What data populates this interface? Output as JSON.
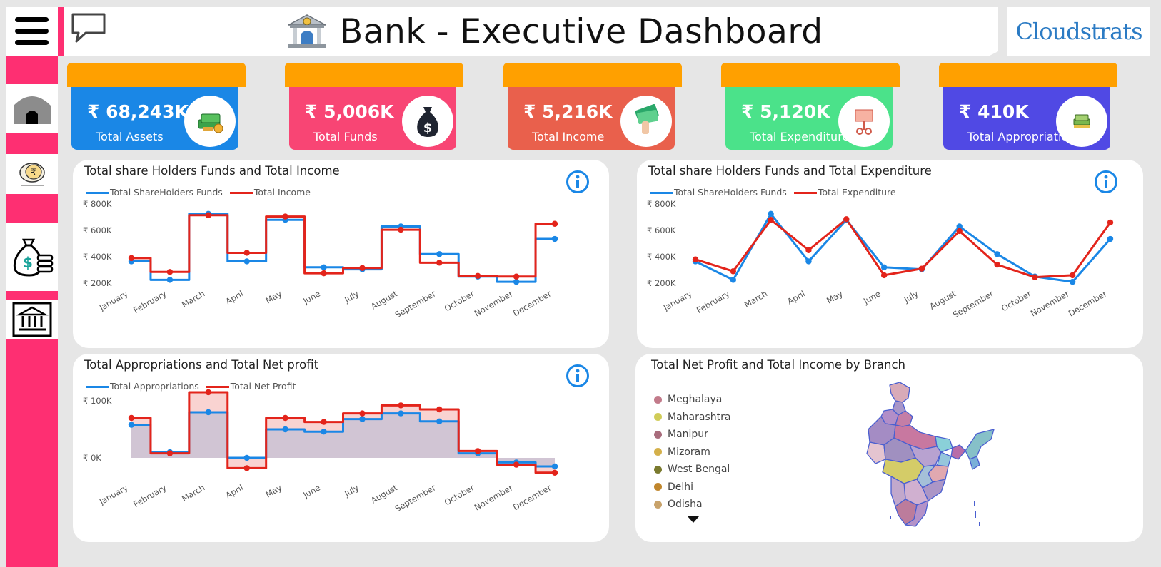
{
  "header": {
    "title": "Bank - Executive Dashboard",
    "logo_text": "Cloudstrats"
  },
  "sidebar": {
    "items": [
      {
        "icon": "home-icon"
      },
      {
        "icon": "rupee-coin-icon"
      },
      {
        "icon": "money-bag-icon"
      },
      {
        "icon": "bank-building-icon"
      }
    ]
  },
  "kpis": [
    {
      "value": "₹ 68,243K",
      "label": "Total Assets",
      "color": "#1a87e6",
      "icon": "cash-stack-icon"
    },
    {
      "value": "₹ 5,006K",
      "label": "Total Funds",
      "color": "#f84574",
      "icon": "money-bag-icon"
    },
    {
      "value": "₹ 5,216K",
      "label": "Total Income",
      "color": "#e9604c",
      "icon": "cash-hand-icon"
    },
    {
      "value": "₹ 5,120K",
      "label": "Total Expenditure",
      "color": "#4be28a",
      "icon": "money-tree-icon"
    },
    {
      "value": "₹ 410K",
      "label": "Total Appropriations",
      "color": "#5049e4",
      "icon": "cash-bundle-icon"
    }
  ],
  "charts": {
    "funds_income": {
      "title": "Total share Holders Funds and Total Income"
    },
    "funds_expenditure": {
      "title": "Total share Holders Funds and Total Expenditure"
    },
    "appropriations_profit": {
      "title": "Total Appropriations and Total Net profit"
    },
    "map": {
      "title": "Total Net Profit and Total Income by Branch",
      "legend": [
        {
          "name": "Meghalaya",
          "color": "#c27a8a"
        },
        {
          "name": "Maharashtra",
          "color": "#d0cc58"
        },
        {
          "name": "Manipur",
          "color": "#a86c7c"
        },
        {
          "name": "Mizoram",
          "color": "#d4b04a"
        },
        {
          "name": "West Bengal",
          "color": "#7a7a2e"
        },
        {
          "name": "Delhi",
          "color": "#c0862c"
        },
        {
          "name": "Odisha",
          "color": "#c8a26a"
        }
      ]
    }
  },
  "chart_data": [
    {
      "type": "line",
      "title": "Total share Holders Funds and Total Income",
      "categories": [
        "January",
        "February",
        "March",
        "April",
        "May",
        "June",
        "July",
        "August",
        "September",
        "October",
        "November",
        "December"
      ],
      "series": [
        {
          "name": "Total ShareHolders Funds",
          "color": "#1a87e6",
          "values": [
            365,
            225,
            725,
            365,
            680,
            320,
            305,
            630,
            420,
            250,
            210,
            535
          ]
        },
        {
          "name": "Total Income",
          "color": "#e3241b",
          "values": [
            390,
            285,
            715,
            430,
            705,
            275,
            315,
            605,
            355,
            255,
            250,
            650
          ]
        }
      ],
      "y_ticks": [
        "₹ 200K",
        "₹ 400K",
        "₹ 600K",
        "₹ 800K"
      ],
      "ylim": [
        200,
        800
      ],
      "step": true,
      "legend": "top-left"
    },
    {
      "type": "line",
      "title": "Total share Holders Funds and Total Expenditure",
      "categories": [
        "January",
        "February",
        "March",
        "April",
        "May",
        "June",
        "July",
        "August",
        "September",
        "October",
        "November",
        "December"
      ],
      "series": [
        {
          "name": "Total ShareHolders Funds",
          "color": "#1a87e6",
          "values": [
            365,
            225,
            725,
            365,
            680,
            320,
            305,
            630,
            420,
            250,
            210,
            535
          ]
        },
        {
          "name": "Total Expenditure",
          "color": "#e3241b",
          "values": [
            380,
            290,
            680,
            450,
            685,
            260,
            310,
            595,
            340,
            245,
            260,
            660
          ]
        }
      ],
      "y_ticks": [
        "₹ 200K",
        "₹ 400K",
        "₹ 600K",
        "₹ 800K"
      ],
      "ylim": [
        200,
        800
      ],
      "step": false,
      "legend": "top-left"
    },
    {
      "type": "area",
      "title": "Total Appropriations and Total Net profit",
      "categories": [
        "January",
        "February",
        "March",
        "April",
        "May",
        "June",
        "July",
        "August",
        "September",
        "October",
        "November",
        "December"
      ],
      "series": [
        {
          "name": "Total Appropriations",
          "color": "#1a87e6",
          "values": [
            58,
            10,
            80,
            0,
            50,
            46,
            68,
            78,
            64,
            8,
            -8,
            -15
          ]
        },
        {
          "name": "Total Net Profit",
          "color": "#e3241b",
          "values": [
            70,
            8,
            115,
            -18,
            70,
            63,
            78,
            92,
            85,
            12,
            -12,
            -26
          ]
        }
      ],
      "y_ticks": [
        "₹ 0K",
        "₹ 100K"
      ],
      "ylim": [
        -30,
        120
      ],
      "step": true,
      "legend": "top-left"
    }
  ]
}
